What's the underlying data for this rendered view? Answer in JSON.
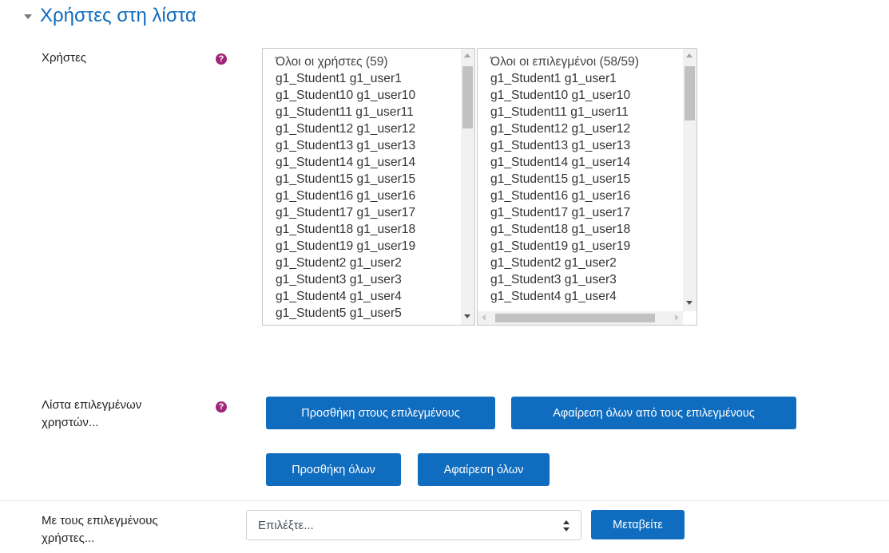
{
  "section": {
    "title": "Χρήστες στη λίστα"
  },
  "users_field": {
    "label": "Χρήστες"
  },
  "all_users_list": {
    "header": "Όλοι οι χρήστες (59)",
    "items": [
      "g1_Student1 g1_user1",
      "g1_Student10 g1_user10",
      "g1_Student11 g1_user11",
      "g1_Student12 g1_user12",
      "g1_Student13 g1_user13",
      "g1_Student14 g1_user14",
      "g1_Student15 g1_user15",
      "g1_Student16 g1_user16",
      "g1_Student17 g1_user17",
      "g1_Student18 g1_user18",
      "g1_Student19 g1_user19",
      "g1_Student2 g1_user2",
      "g1_Student3 g1_user3",
      "g1_Student4 g1_user4",
      "g1_Student5 g1_user5"
    ]
  },
  "selected_users_list": {
    "header": "Όλοι οι επιλεγμένοι (58/59)",
    "items": [
      "g1_Student1 g1_user1",
      "g1_Student10 g1_user10",
      "g1_Student11 g1_user11",
      "g1_Student12 g1_user12",
      "g1_Student13 g1_user13",
      "g1_Student14 g1_user14",
      "g1_Student15 g1_user15",
      "g1_Student16 g1_user16",
      "g1_Student17 g1_user17",
      "g1_Student18 g1_user18",
      "g1_Student19 g1_user19",
      "g1_Student2 g1_user2",
      "g1_Student3 g1_user3",
      "g1_Student4 g1_user4"
    ]
  },
  "selection_field": {
    "label": "Λίστα επιλεγμένων χρηστών..."
  },
  "buttons": {
    "add_selected": "Προσθήκη στους επιλεγμένους",
    "remove_all_selected": "Αφαίρεση όλων από τους επιλεγμένους",
    "add_all": "Προσθήκη όλων",
    "remove_all": "Αφαίρεση όλων",
    "go": "Μεταβείτε"
  },
  "with_selected": {
    "label": "Με τους επιλεγμένους χρήστες...",
    "select_value": "Επιλέξτε..."
  },
  "colors": {
    "accent": "#0f6cbf",
    "help_icon": "#a0267a"
  }
}
